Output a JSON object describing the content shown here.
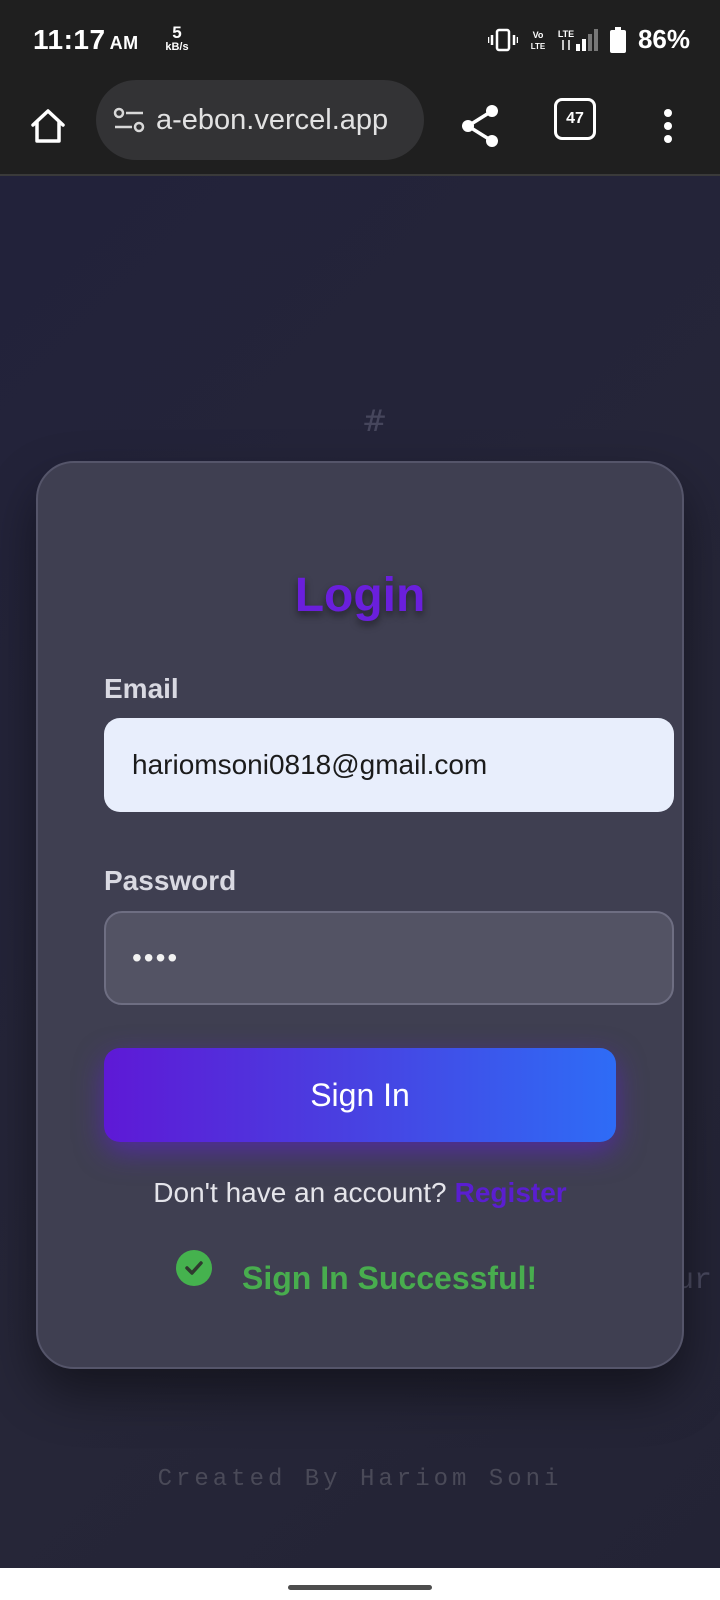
{
  "status_bar": {
    "time": "11:17",
    "ampm": "AM",
    "net_speed": "5",
    "net_speed_unit": "kB/s",
    "battery": "86%",
    "icons": [
      "vibrate-icon",
      "volte-icon",
      "lte-icon",
      "signal-icon",
      "battery-icon"
    ]
  },
  "browser": {
    "url": "a-ebon.vercel.app",
    "tab_count": "47",
    "icons": [
      "home-icon",
      "site-settings-icon",
      "share-icon",
      "tabs-icon",
      "more-vert-icon"
    ]
  },
  "page": {
    "hash_deco": "#",
    "side_deco": "ur",
    "login": {
      "title": "Login",
      "email_label": "Email",
      "email_value": "hariomsoni0818@gmail.com",
      "password_label": "Password",
      "password_value": "••••",
      "sign_in_label": "Sign In",
      "register_prompt": "Don't have an account?",
      "register_link": "Register",
      "success_message": "Sign In Successful!"
    },
    "credit": "Created By Hariom Soni"
  },
  "colors": {
    "accent": "#6a1fdc",
    "button_start": "#5e19d6",
    "button_end": "#2e6cf6",
    "success": "#48ad4e",
    "card_bg": "#3f3f51",
    "page_bg": "#23233a"
  }
}
